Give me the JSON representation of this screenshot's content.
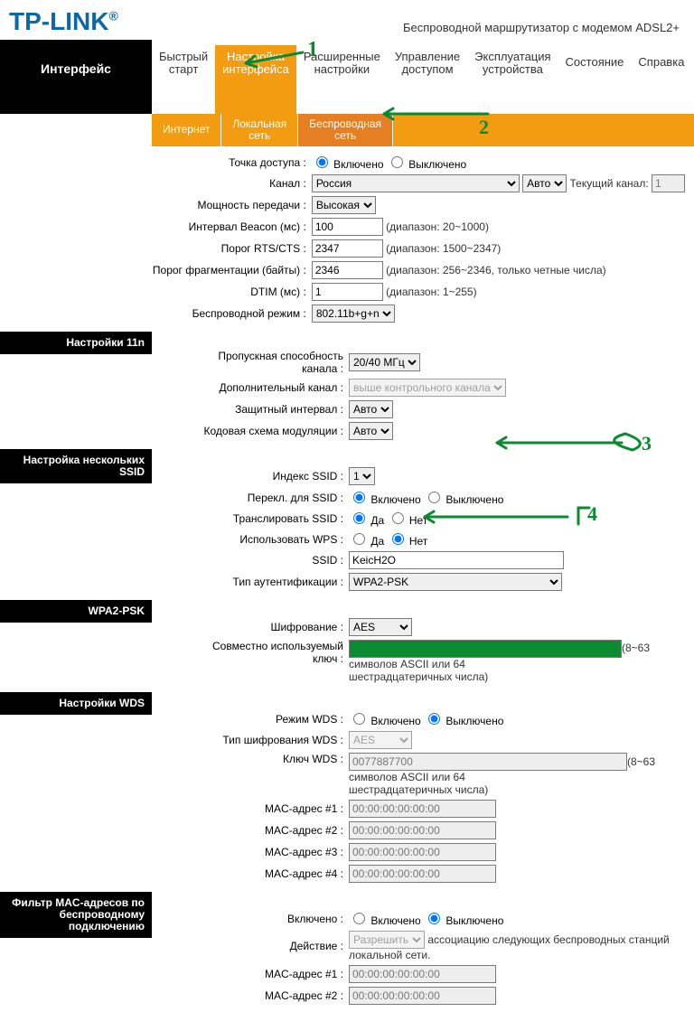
{
  "brand": "TP-LINK",
  "brand_reg": "®",
  "model_desc": "Беспроводной маршрутизатор с модемом ADSL2+",
  "side_title": "Интерфейс",
  "tabs1": {
    "quick": "Быстрый\nстарт",
    "iface": "Настройка\nинтерфейса",
    "adv": "Расширенные\nнастройки",
    "access": "Управление\nдоступом",
    "maint": "Эксплуатация\nустройства",
    "status": "Состояние",
    "help": "Справка"
  },
  "tabs2": {
    "internet": "Интернет",
    "lan": "Локальная\nсеть",
    "wlan": "Беспроводная\nсеть"
  },
  "ap": {
    "label": "Точка доступа",
    "on": "Включено",
    "off": "Выключено",
    "channel_label": "Канал",
    "channel_country": "Россия",
    "channel_auto": "Авто",
    "cur_channel_label": "Текущий канал:",
    "cur_channel": "1",
    "tx_power_label": "Мощность передачи",
    "tx_power": "Высокая",
    "beacon_label": "Интервал Beacon (мс)",
    "beacon": "100",
    "beacon_hint": "(диапазон: 20~1000)",
    "rts_label": "Порог RTS/CTS",
    "rts": "2347",
    "rts_hint": "(диапазон: 1500~2347)",
    "frag_label": "Порог фрагментации (байты)",
    "frag": "2346",
    "frag_hint": "(диапазон: 256~2346, только четные числа)",
    "dtim_label": "DTIM (мс)",
    "dtim": "1",
    "dtim_hint": "(диапазон: 1~255)",
    "mode_label": "Беспроводной режим",
    "mode": "802.11b+g+n"
  },
  "sec_11n": "Настройки 11n",
  "n11": {
    "bw_label": "Пропускная способность\nканала",
    "bw": "20/40 МГц",
    "ext_label": "Дополнительный канал",
    "ext": "выше контрольного канала",
    "gi_label": "Защитный интервал",
    "gi": "Авто",
    "mcs_label": "Кодовая схема модуляции",
    "mcs": "Авто"
  },
  "sec_ssid": "Настройка нескольких SSID",
  "ssid": {
    "idx_label": "Индекс SSID",
    "idx": "1",
    "perssid_label": "Перекл. для SSID",
    "perssid_on": "Включено",
    "perssid_off": "Выключено",
    "broadcast_label": "Транслировать SSID",
    "yes": "Да",
    "no": "Нет",
    "wps_label": "Использовать WPS",
    "ssid_label": "SSID",
    "ssid_value": "KeicH2O",
    "auth_label": "Тип аутентификации",
    "auth": "WPA2-PSK"
  },
  "sec_wpa": "WPA2-PSK",
  "wpa": {
    "enc_label": "Шифрование",
    "enc": "AES",
    "psk_label": "Совместно используемый\nключ",
    "psk_hint1": "(8~63 символов ASCII или 64",
    "psk_hint2": "шестрадцатеричных числа)"
  },
  "sec_wds": "Настройки WDS",
  "wds": {
    "mode_label": "Режим WDS",
    "on": "Включено",
    "off": "Выключено",
    "enc_label": "Тип шифрования WDS",
    "enc": "AES",
    "key_label": "Ключ WDS",
    "key": "0077887700",
    "key_hint1": "(8~63 символов ASCII или 64",
    "key_hint2": "шестрадцатеричных числа)",
    "mac1_label": "MAC-адрес #1",
    "mac2_label": "MAC-адрес #2",
    "mac3_label": "MAC-адрес #3",
    "mac4_label": "MAC-адрес #4",
    "mac_val": "00:00:00:00:00:00"
  },
  "sec_filter": "Фильтр MAC-адресов по\nбеспроводному\nподключению",
  "filter": {
    "enabled_label": "Включено",
    "on": "Включено",
    "off": "Выключено",
    "action_label": "Действие",
    "action": "Разрешить",
    "action_hint": "ассоциацию следующих беспроводных станций локальной сети.",
    "mac1_label": "MAC-адрес #1",
    "mac2_label": "MAC-адрес #2",
    "mac_val": "00:00:00:00:00:00"
  },
  "ann": {
    "one": "1",
    "two": "2",
    "three": "3",
    "four": "4"
  }
}
